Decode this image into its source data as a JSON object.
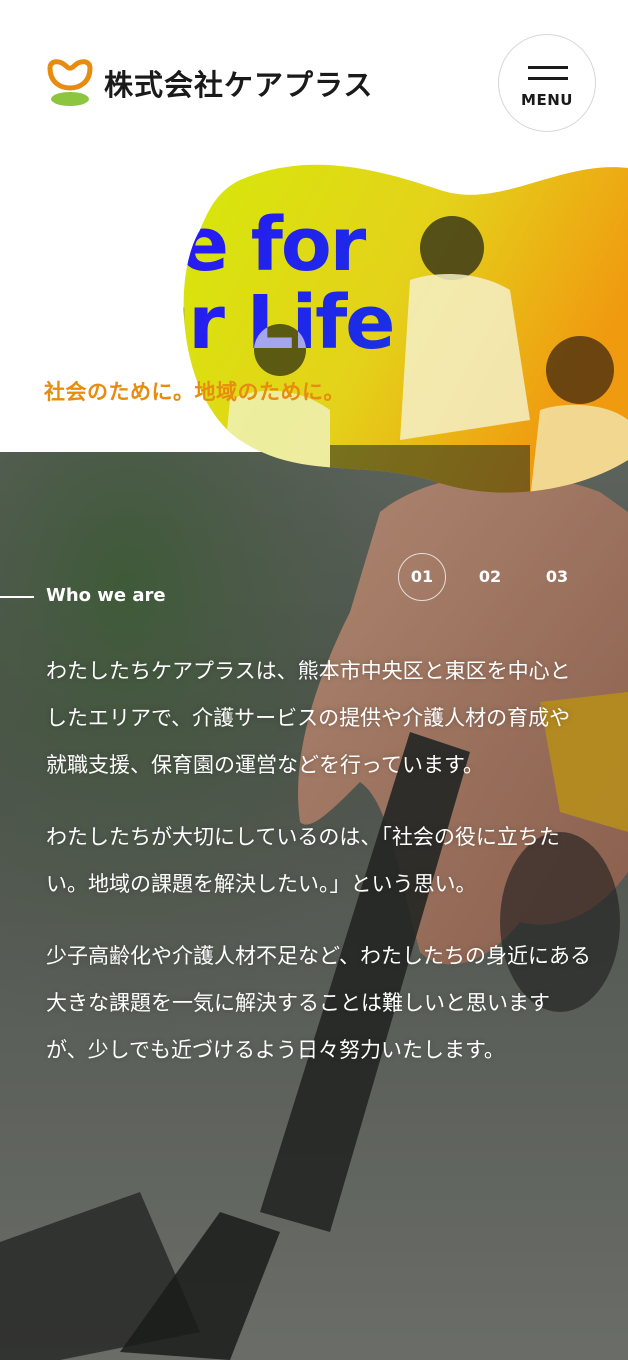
{
  "header": {
    "logo_text": "株式会社ケアプラス",
    "menu_label": "MENU"
  },
  "hero": {
    "title_line1": "Care for",
    "title_line2": "Your Life",
    "subtitle": "社会のために。地域のために。"
  },
  "about": {
    "section_label": "Who we are",
    "pager": [
      "01",
      "02",
      "03"
    ],
    "active_page": "01",
    "paragraphs": [
      "わたしたちケアプラスは、熊本市中央区と東区を中心としたエリアで、介護サービスの提供や介護人材の育成や就職支援、保育園の運営などを行っています。",
      "わたしたちが大切にしているのは、「社会の役に立ちたい。地域の課題を解決したい。」という思い。",
      "少子高齢化や介護人材不足など、わたしたちの身近にある大きな課題を一気に解決することは難しいと思いますが、少しでも近づけるよう日々努力いたします。"
    ]
  },
  "colors": {
    "accent_orange": "#e88c10",
    "accent_green": "#8cc63f",
    "text_dark": "#111111"
  }
}
